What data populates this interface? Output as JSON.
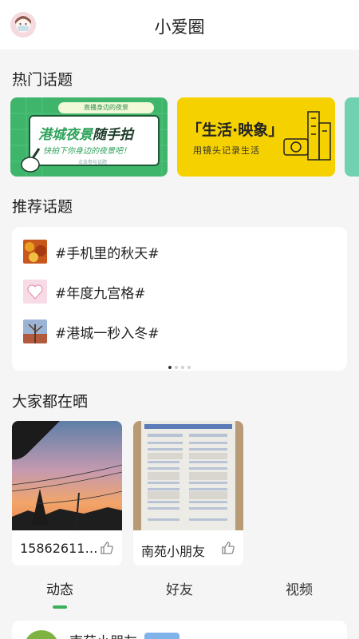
{
  "header": {
    "title": "小爱圈",
    "avatar": "user-avatar"
  },
  "sections": {
    "hot": "热门话题",
    "recommended": "推荐话题",
    "everyone": "大家都在晒"
  },
  "hot_topics": [
    {
      "tag": "直播身边的夜景",
      "title_green": "港城夜景",
      "title_dark": "随手拍",
      "subtitle": "快拍下你身边的夜景吧！",
      "small": "点击参与话题",
      "color": "#3fb56b"
    },
    {
      "title": "「生活·映象」",
      "subtitle": "用镜头记录生活",
      "color": "#f6d100"
    },
    {
      "color": "#6fd1b2"
    }
  ],
  "recommended_topics": [
    {
      "label": "#手机里的秋天#"
    },
    {
      "label": "#年度九宫格#"
    },
    {
      "label": "#港城一秒入冬#"
    }
  ],
  "carousel": {
    "pages": 4,
    "active": 1
  },
  "shared_posts": [
    {
      "caption": "15862611…"
    },
    {
      "caption": "南苑小朋友"
    }
  ],
  "tabs": [
    {
      "label": "动态",
      "active": true
    },
    {
      "label": "好友",
      "active": false
    },
    {
      "label": "视频",
      "active": false
    }
  ],
  "feed_post": {
    "name": "南苑小朋友",
    "badge_color": "#7fb3ea"
  },
  "colors": {
    "accent": "#3caf5a",
    "background": "#f5f5f5"
  }
}
